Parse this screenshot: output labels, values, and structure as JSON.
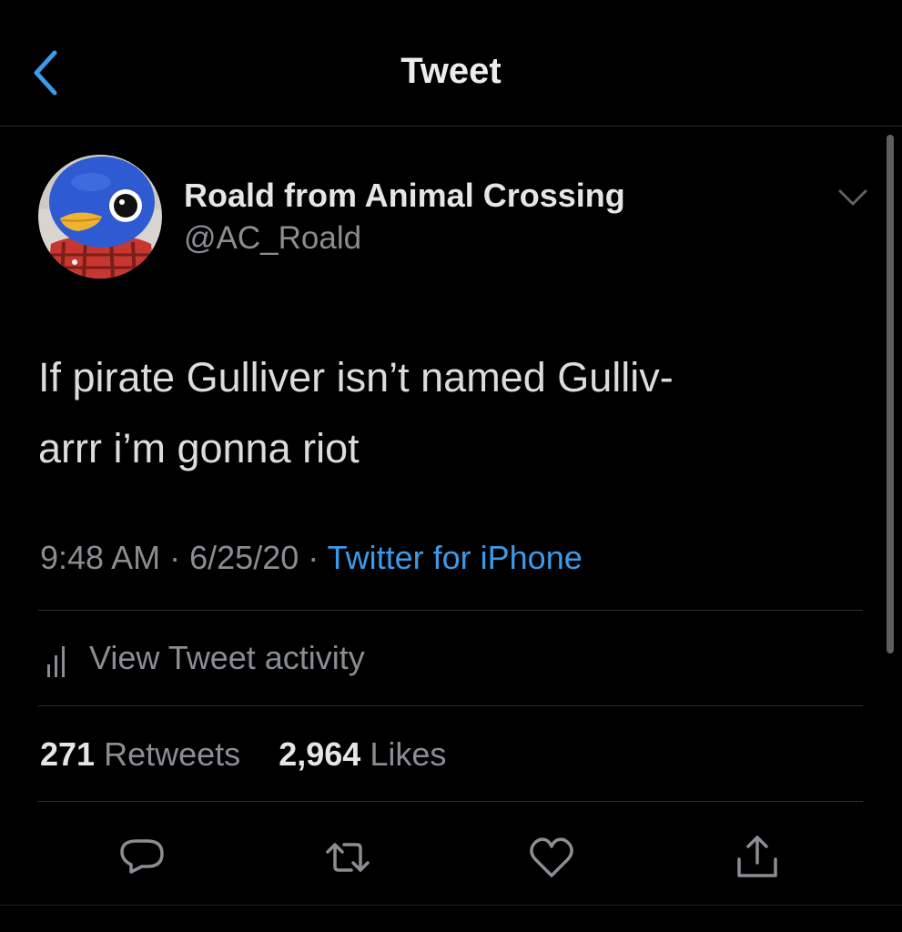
{
  "nav": {
    "title": "Tweet",
    "back_icon": "chevron-left-icon"
  },
  "author": {
    "display_name": "Roald from Animal Crossing",
    "handle": "@AC_Roald",
    "avatar": "penguin-avatar"
  },
  "tweet": {
    "line1": "If pirate Gulliver isn’t named Gulliv-",
    "line2": "arrr i’m gonna riot"
  },
  "meta": {
    "time": "9:48 AM",
    "separator": "·",
    "date": "6/25/20",
    "source": "Twitter for iPhone"
  },
  "activity": {
    "label": "View Tweet activity",
    "icon": "bar-chart-icon"
  },
  "stats": {
    "retweets_count": "271",
    "retweets_label": "Retweets",
    "likes_count": "2,964",
    "likes_label": "Likes"
  },
  "actions": [
    {
      "name": "reply",
      "icon": "reply-icon"
    },
    {
      "name": "retweet",
      "icon": "retweet-icon"
    },
    {
      "name": "like",
      "icon": "heart-icon"
    },
    {
      "name": "share",
      "icon": "share-icon"
    }
  ],
  "colors": {
    "background": "#000000",
    "accent": "#3b9be8",
    "muted_text": "#8a8d91",
    "primary_text": "#e6e6e6"
  }
}
